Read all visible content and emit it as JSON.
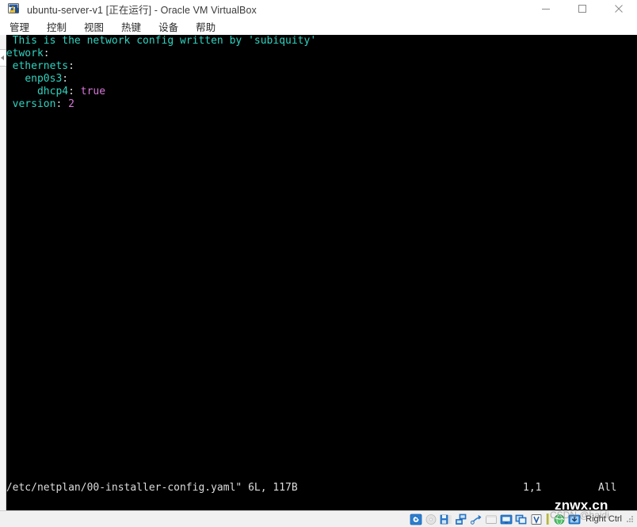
{
  "window": {
    "title": "ubuntu-server-v1 [正在运行] - Oracle VM VirtualBox",
    "icon": "virtualbox-vm-icon",
    "controls": {
      "minimize": "minimize-icon",
      "maximize": "maximize-icon",
      "close": "close-icon"
    }
  },
  "menubar": {
    "items": [
      {
        "label": "管理"
      },
      {
        "label": "控制"
      },
      {
        "label": "视图"
      },
      {
        "label": "热键"
      },
      {
        "label": "设备"
      },
      {
        "label": "帮助"
      }
    ]
  },
  "terminal": {
    "lines": [
      {
        "indent": "",
        "segments": [
          {
            "text": "# This is the network config written by 'subiquity'",
            "cls": "c-comment"
          }
        ]
      },
      {
        "indent": "",
        "segments": [
          {
            "text": "network",
            "cls": "c-key"
          },
          {
            "text": ":",
            "cls": "c-punct"
          }
        ]
      },
      {
        "indent": "  ",
        "segments": [
          {
            "text": "ethernets",
            "cls": "c-key"
          },
          {
            "text": ":",
            "cls": "c-punct"
          }
        ]
      },
      {
        "indent": "    ",
        "segments": [
          {
            "text": "enp0s3",
            "cls": "c-key"
          },
          {
            "text": ":",
            "cls": "c-punct"
          }
        ]
      },
      {
        "indent": "      ",
        "segments": [
          {
            "text": "dhcp4",
            "cls": "c-key"
          },
          {
            "text": ": ",
            "cls": "c-punct"
          },
          {
            "text": "true",
            "cls": "c-value"
          }
        ]
      },
      {
        "indent": "  ",
        "segments": [
          {
            "text": "version",
            "cls": "c-key"
          },
          {
            "text": ": ",
            "cls": "c-punct"
          },
          {
            "text": "2",
            "cls": "c-value"
          }
        ]
      }
    ],
    "cursor_char": "#",
    "empty_marker": "~",
    "empty_rows": 31
  },
  "vim_status": {
    "file": "\"/etc/netplan/00-installer-config.yaml\" 6L, 117B",
    "position": "1,1",
    "scroll": "All"
  },
  "watermarks": {
    "primary": "znwx.cn",
    "secondary": "CSDN @haidi"
  },
  "vbox_statusbar": {
    "icons": [
      {
        "name": "hard-disk-icon"
      },
      {
        "name": "optical-disk-icon"
      },
      {
        "name": "floppy-disk-icon"
      },
      {
        "name": "network-adapter-icon"
      },
      {
        "name": "usb-icon"
      },
      {
        "name": "shared-folders-icon"
      },
      {
        "name": "display-icon"
      },
      {
        "name": "recording-icon"
      },
      {
        "name": "virtualbox-features-icon"
      }
    ],
    "extra_icons": [
      {
        "name": "globe-icon"
      },
      {
        "name": "mouse-integration-icon"
      }
    ],
    "host_key": "Right Ctrl"
  }
}
